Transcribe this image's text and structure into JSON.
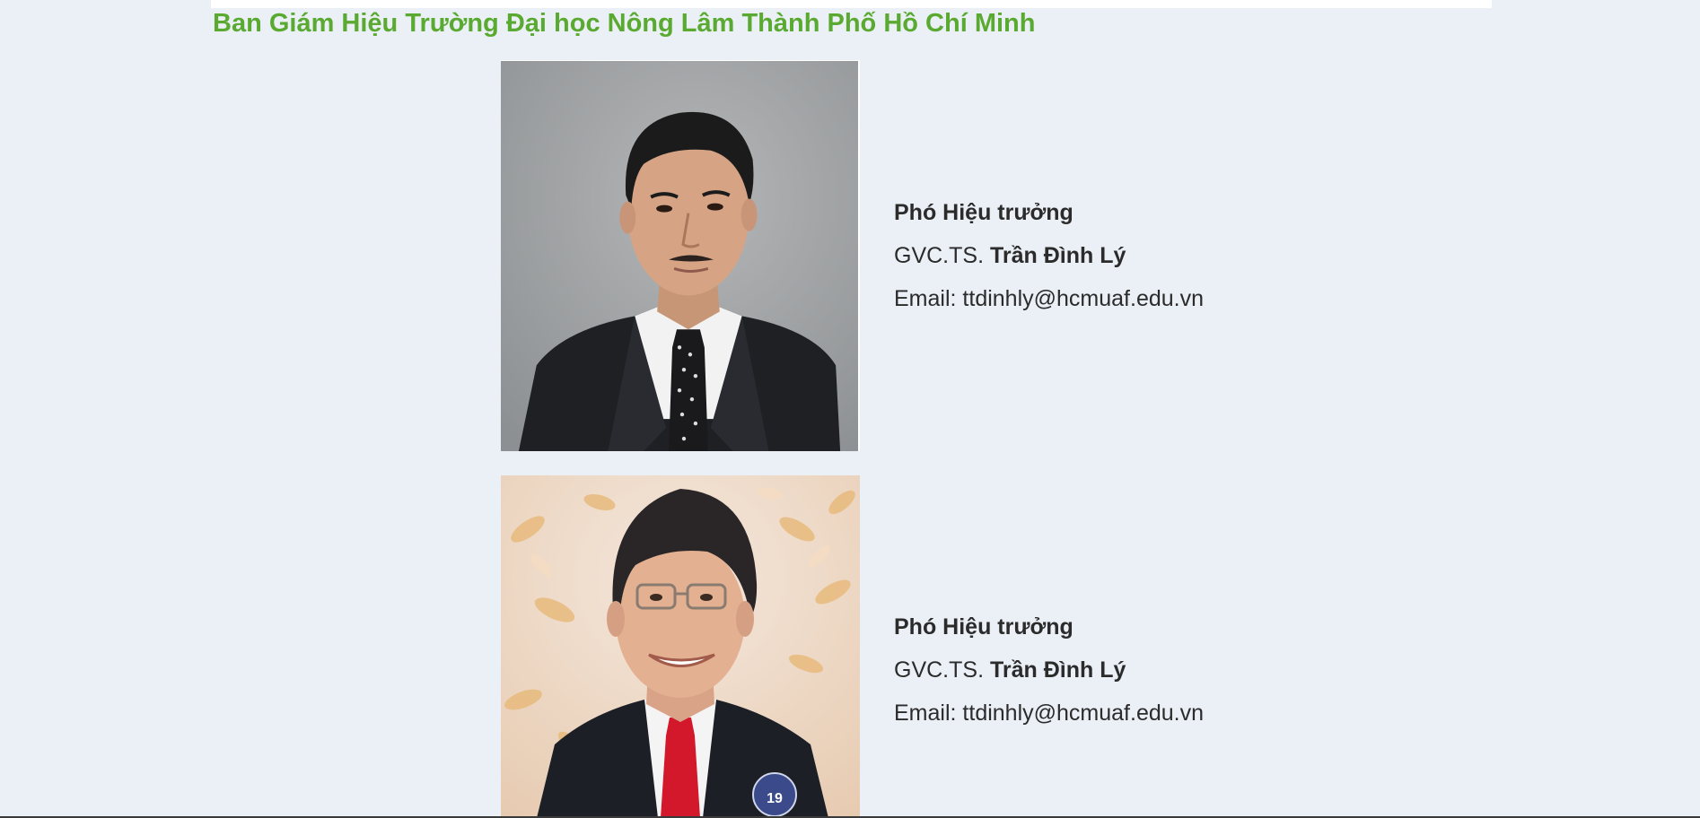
{
  "page": {
    "title": "Ban Giám Hiệu Trường Đại học Nông Lâm Thành Phố Hồ Chí Minh",
    "title_color": "#5aaa32",
    "background": "#ebf0f6"
  },
  "staff": [
    {
      "role": "Phó Hiệu trưởng",
      "degree_prefix": "GVC.TS.",
      "name": "Trần Đình Lý",
      "email_label": "Email:",
      "email": "ttdinhly@hcmuaf.edu.vn",
      "photo": "portrait-man-black-suit-polka-dot-tie-gray-background"
    },
    {
      "role": "Phó Hiệu trưởng",
      "degree_prefix": "GVC.TS.",
      "name": "Trần Đình Lý",
      "email_label": "Email:",
      "email": "ttdinhly@hcmuaf.edu.vn",
      "photo": "portrait-smiling-man-glasses-red-tie-floral-background",
      "badge_text": "19"
    }
  ]
}
